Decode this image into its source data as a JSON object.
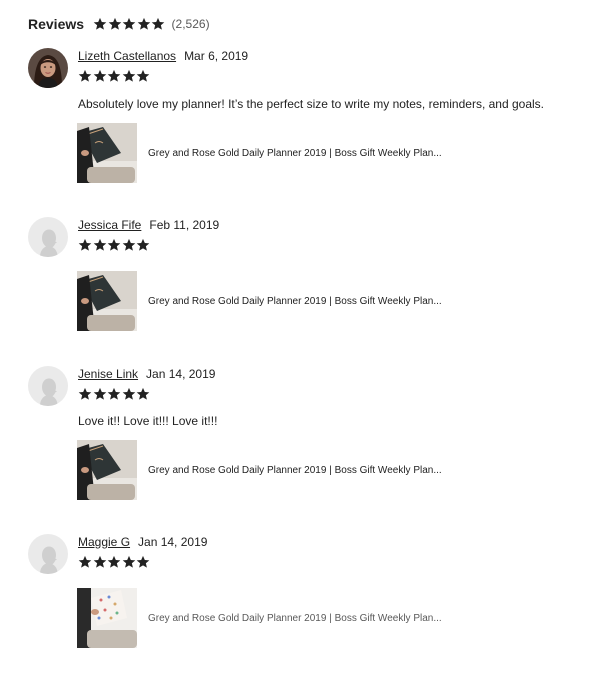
{
  "reviews_header": {
    "title": "Reviews",
    "rating": 5,
    "count": "(2,526)"
  },
  "colors": {
    "star": "#222222",
    "text": "#222222",
    "muted": "#595959"
  },
  "reviews": [
    {
      "author": "Lizeth Castellanos",
      "date": "Mar 6, 2019",
      "rating": 5,
      "text": "Absolutely love my planner! It’s the perfect size to write my notes, reminders, and goals.",
      "avatar": "user-photo",
      "product_title": "Grey and Rose Gold Daily Planner 2019 | Boss Gift Weekly Plan..."
    },
    {
      "author": "Jessica Fife",
      "date": "Feb 11, 2019",
      "rating": 5,
      "text": "",
      "avatar": "default-avatar-icon",
      "product_title": "Grey and Rose Gold Daily Planner 2019 | Boss Gift Weekly Plan..."
    },
    {
      "author": "Jenise Link",
      "date": "Jan 14, 2019",
      "rating": 5,
      "text": "Love it!! Love it!!! Love it!!!",
      "avatar": "default-avatar-icon",
      "product_title": "Grey and Rose Gold Daily Planner 2019 | Boss Gift Weekly Plan..."
    },
    {
      "author": "Maggie G",
      "date": "Jan 14, 2019",
      "rating": 5,
      "text": "",
      "avatar": "default-avatar-icon",
      "product_title": "Grey and Rose Gold Daily Planner 2019 | Boss Gift Weekly Plan..."
    }
  ]
}
